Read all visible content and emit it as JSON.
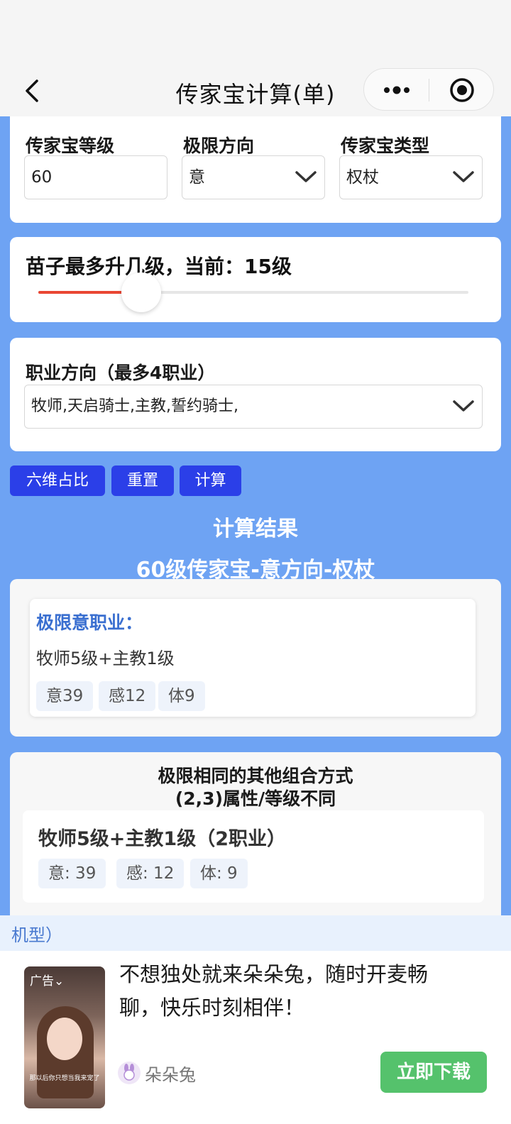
{
  "navbar": {
    "title": "传家宝计算(单)"
  },
  "form": {
    "level_label": "传家宝等级",
    "level_value": "60",
    "direction_label": "极限方向",
    "direction_value": "意",
    "type_label": "传家宝类型",
    "type_value": "权杖"
  },
  "slider": {
    "title": "苗子最多升几级，当前：15级",
    "fill_fraction": 0.24
  },
  "profession": {
    "label": "职业方向（最多4职业）",
    "value": "牧师,天启骑士,主教,誓约骑士,"
  },
  "buttons": {
    "ratio": "六维占比",
    "reset": "重置",
    "calculate": "计算"
  },
  "result": {
    "heading": "计算结果",
    "subheading": "60级传家宝-意方向-权杖",
    "best": {
      "title": "极限意职业：",
      "combo": "牧师5级+主教1级",
      "tags": [
        "意39",
        "感12",
        "体9"
      ]
    },
    "others": {
      "title_line1": "极限相同的其他组合方式",
      "title_line2": "(2,3)属性/等级不同",
      "item_title": "牧师5级+主教1级（2职业）",
      "tags": [
        "意: 39",
        "感: 12",
        "体: 9"
      ]
    }
  },
  "ad": {
    "strip_text": "机型）",
    "badge": "广告⌄",
    "image_caption": "那以后你只想当我来宠了",
    "text": "不想独处就来朵朵兔，随时开麦畅聊，快乐时刻相伴！",
    "brand": "朵朵兔",
    "cta": "立即下载"
  },
  "colors": {
    "page_bg": "#6ea3f3",
    "button_blue": "#2b3fe8",
    "slider_red": "#e94633",
    "cta_green": "#55c26c",
    "accent_text": "#3a6fd0"
  }
}
